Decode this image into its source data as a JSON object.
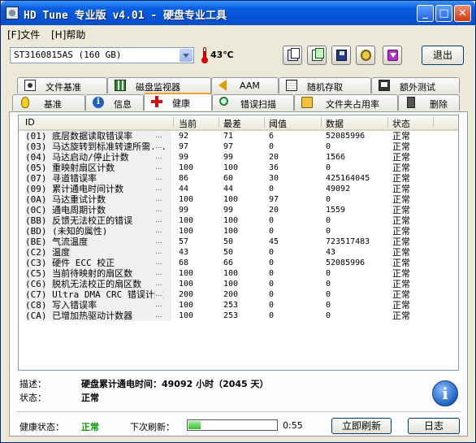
{
  "title": "HD Tune 专业版 v4.01 - 硬盘专业工具",
  "window_buttons": {
    "minimize": "_",
    "maximize": "□",
    "close": "✕"
  },
  "menu": [
    {
      "label": "[F]文件"
    },
    {
      "label": "[H]帮助"
    }
  ],
  "toolbar": {
    "drive": "ST3160815AS (160 GB)",
    "temperature": "43℃",
    "icons": [
      "copy-text-icon",
      "copy-screenshot-icon",
      "save-icon",
      "options-icon",
      "download-icon"
    ],
    "exit_label": "退出"
  },
  "tabs_top": [
    {
      "label": "文件基准",
      "icon": "file-benchmark-icon"
    },
    {
      "label": "磁盘监视器",
      "icon": "disk-monitor-icon"
    },
    {
      "label": "AAM",
      "icon": "speaker-icon"
    },
    {
      "label": "随机存取",
      "icon": "random-access-icon"
    },
    {
      "label": "额外测试",
      "icon": "extra-tests-icon"
    }
  ],
  "tabs_bottom": [
    {
      "label": "基准",
      "icon": "benchmark-icon"
    },
    {
      "label": "信息",
      "icon": "info-icon"
    },
    {
      "label": "健康",
      "icon": "health-cross-icon",
      "active": true
    },
    {
      "label": "错误扫描",
      "icon": "error-scan-icon"
    },
    {
      "label": "文件夹占用率",
      "icon": "folder-icon"
    },
    {
      "label": "删除",
      "icon": "trash-icon"
    }
  ],
  "smart_table": {
    "columns": [
      "ID",
      "当前",
      "最差",
      "阈值",
      "数据",
      "状态"
    ],
    "rows": [
      {
        "id": "(01) 底层数据读取错误率",
        "current": "92",
        "worst": "71",
        "threshold": "6",
        "data": "52085996",
        "status": "正常"
      },
      {
        "id": "(03) 马达旋转到标准转速所需...",
        "current": "97",
        "worst": "97",
        "threshold": "0",
        "data": "0",
        "status": "正常"
      },
      {
        "id": "(04) 马达启动/停止计数",
        "current": "99",
        "worst": "99",
        "threshold": "20",
        "data": "1566",
        "status": "正常"
      },
      {
        "id": "(05) 重映射扇区计数",
        "current": "100",
        "worst": "100",
        "threshold": "36",
        "data": "0",
        "status": "正常"
      },
      {
        "id": "(07) 寻道错误率",
        "current": "86",
        "worst": "60",
        "threshold": "30",
        "data": "425164045",
        "status": "正常"
      },
      {
        "id": "(09) 累计通电时间计数",
        "current": "44",
        "worst": "44",
        "threshold": "0",
        "data": "49092",
        "status": "正常"
      },
      {
        "id": "(0A) 马达重试计数",
        "current": "100",
        "worst": "100",
        "threshold": "97",
        "data": "0",
        "status": "正常"
      },
      {
        "id": "(0C) 通电周期计数",
        "current": "99",
        "worst": "99",
        "threshold": "20",
        "data": "1559",
        "status": "正常"
      },
      {
        "id": "(BB) 反馈无法校正的错误",
        "current": "100",
        "worst": "100",
        "threshold": "0",
        "data": "0",
        "status": "正常"
      },
      {
        "id": "(BD) (未知的属性)",
        "current": "100",
        "worst": "100",
        "threshold": "0",
        "data": "0",
        "status": "正常"
      },
      {
        "id": "(BE) 气流温度",
        "current": "57",
        "worst": "50",
        "threshold": "45",
        "data": "723517483",
        "status": "正常"
      },
      {
        "id": "(C2) 温度",
        "current": "43",
        "worst": "50",
        "threshold": "0",
        "data": "43",
        "status": "正常"
      },
      {
        "id": "(C3) 硬件 ECC 校正",
        "current": "68",
        "worst": "66",
        "threshold": "0",
        "data": "52085996",
        "status": "正常"
      },
      {
        "id": "(C5) 当前待映射的扇区数",
        "current": "100",
        "worst": "100",
        "threshold": "0",
        "data": "0",
        "status": "正常"
      },
      {
        "id": "(C6) 脱机无法校正的扇区数",
        "current": "100",
        "worst": "100",
        "threshold": "0",
        "data": "0",
        "status": "正常"
      },
      {
        "id": "(C7) Ultra DMA CRC 错误计数",
        "current": "200",
        "worst": "200",
        "threshold": "0",
        "data": "0",
        "status": "正常"
      },
      {
        "id": "(C8) 写入错误率",
        "current": "100",
        "worst": "253",
        "threshold": "0",
        "data": "0",
        "status": "正常"
      },
      {
        "id": "(CA) 已增加热驱动计数器",
        "current": "100",
        "worst": "253",
        "threshold": "0",
        "data": "0",
        "status": "正常"
      }
    ]
  },
  "details": {
    "description_label": "描述：",
    "description_value": "硬盘累计通电时间：49092 小时（2045 天）",
    "state_label": "状态：",
    "state_value": "正常"
  },
  "footer": {
    "health_label": "健康状态：",
    "health_value": "正常",
    "health_color": "#0a9a0a",
    "next_refresh_label": "下次刷新：",
    "next_refresh_progress": 0.14,
    "next_refresh_time": "0:55",
    "refresh_button": "立即刷新",
    "log_button": "日志"
  }
}
